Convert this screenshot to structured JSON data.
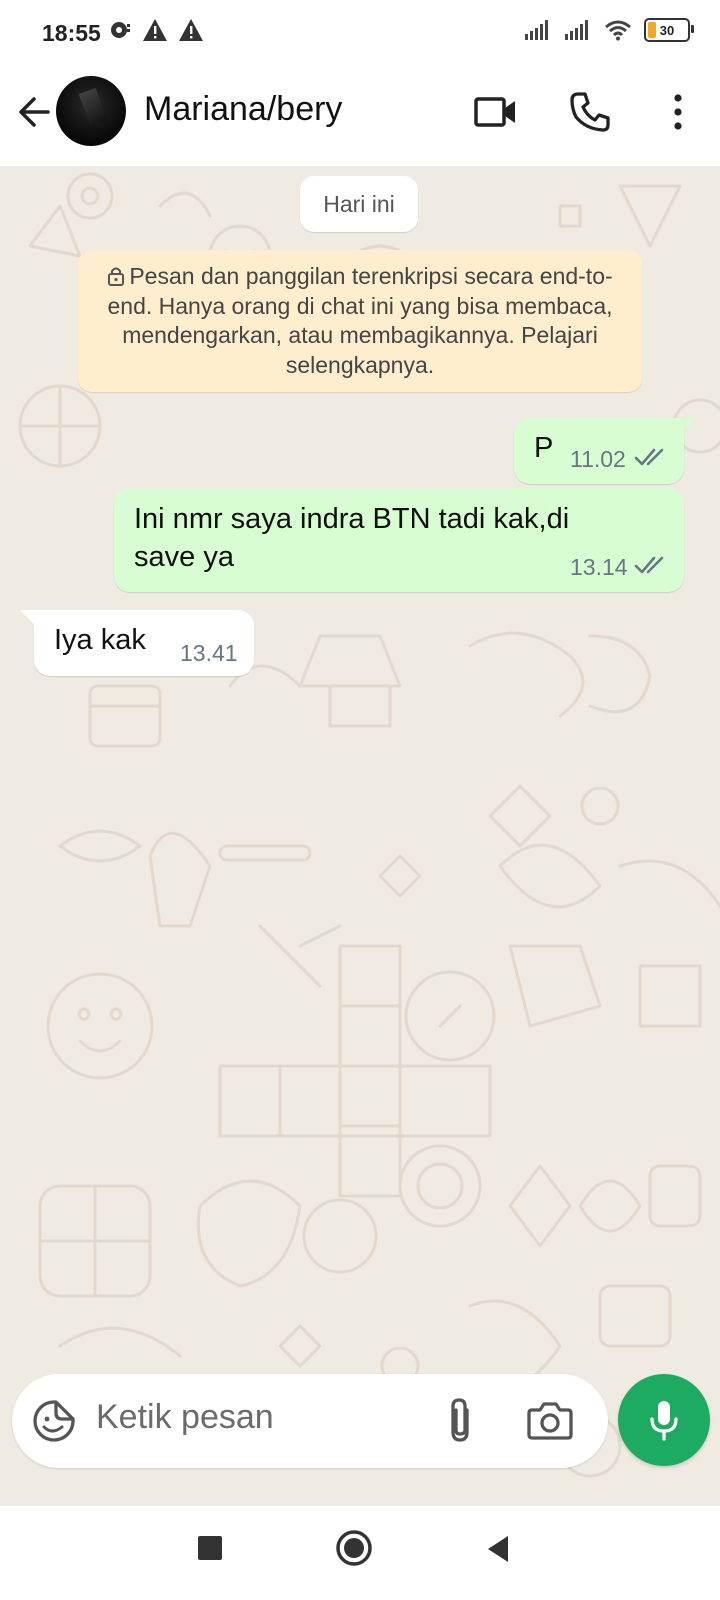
{
  "status_bar": {
    "time": "18:55",
    "battery": "30",
    "icons_left": [
      "sync-icon",
      "warning-icon",
      "warning-icon"
    ],
    "icons_right": [
      "signal-icon",
      "signal-icon",
      "wifi-icon",
      "battery-icon"
    ]
  },
  "header": {
    "contact_name": "Mariana/bery",
    "icons": [
      "back-arrow-icon",
      "video-call-icon",
      "phone-icon",
      "more-vert-icon"
    ]
  },
  "chat": {
    "date_label": "Hari ini",
    "encryption_notice": "Pesan dan panggilan terenkripsi secara end-to-end. Hanya orang di chat ini yang bisa membaca, mendengarkan, atau membagikannya. Pelajari selengkapnya.",
    "messages": [
      {
        "direction": "outgoing",
        "text": "P",
        "time": "11.02",
        "status": "read"
      },
      {
        "direction": "outgoing",
        "text": "Ini nmr saya indra BTN tadi kak,di save ya",
        "time": "13.14",
        "status": "read"
      },
      {
        "direction": "incoming",
        "text": "Iya kak",
        "time": "13.41"
      }
    ]
  },
  "input": {
    "placeholder": "Ketik pesan",
    "icons": [
      "sticker-icon",
      "attach-icon",
      "camera-icon",
      "mic-icon"
    ]
  },
  "colors": {
    "outgoing_bubble": "#d9fdd3",
    "incoming_bubble": "#ffffff",
    "chat_background": "#efeae2",
    "notice_background": "#ffeecd",
    "accent": "#1daa61"
  }
}
